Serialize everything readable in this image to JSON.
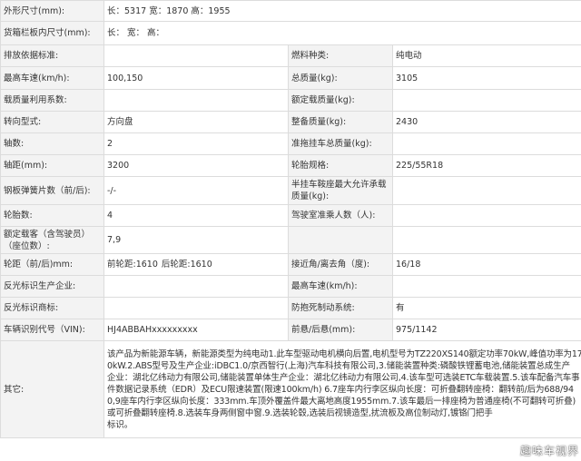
{
  "rows": [
    {
      "l1": "外形尺寸(mm):",
      "v1a": "长：5317 宽：1870 高：1955"
    },
    {
      "l1": "货箱栏板内尺寸(mm):",
      "v1a": "长：  宽：  高："
    },
    {
      "l1": "排放依据标准:",
      "v1": "",
      "l2": "燃料种类:",
      "v2": "纯电动"
    },
    {
      "l1": "最高车速(km/h):",
      "v1": "100,150",
      "l2": "总质量(kg):",
      "v2": "3105"
    },
    {
      "l1": "载质量利用系数:",
      "v1": "",
      "l2": "额定载质量(kg):",
      "v2": ""
    },
    {
      "l1": "转向型式:",
      "v1": "方向盘",
      "l2": "整备质量(kg):",
      "v2": "2430"
    },
    {
      "l1": "轴数:",
      "v1": "2",
      "l2": "准拖挂车总质量(kg):",
      "v2": ""
    },
    {
      "l1": "轴距(mm):",
      "v1": "3200",
      "l2": "轮胎规格:",
      "v2": "225/55R18"
    },
    {
      "l1": "钢板弹簧片数（前/后):",
      "v1": "-/-",
      "l2": "半挂车鞍座最大允许承载质量(kg):",
      "v2": ""
    },
    {
      "l1": "轮胎数:",
      "v1": "4",
      "l2": "驾驶室准乘人数（人):",
      "v2": ""
    },
    {
      "l1": "额定载客（含驾驶员）（座位数）:",
      "v1": "7,9",
      "l2": "",
      "v2": ""
    },
    {
      "l1": "轮距（前/后)mm:",
      "v1a": "前轮距:1610",
      "v1b": "后轮距:1610",
      "l2": "接近角/离去角（度):",
      "v2": "16/18"
    },
    {
      "l1": "反光标识生产企业:",
      "v1": "",
      "l2": "最高车速(km/h):",
      "v2": ""
    },
    {
      "l1": "反光标识商标:",
      "v1": "",
      "l2": "防抱死制动系统:",
      "v2": "有"
    },
    {
      "l1": "车辆识别代号（VIN):",
      "v1": "HJ4ABBAHxxxxxxxxx",
      "l2": "前悬/后悬(mm):",
      "v2": "975/1142"
    }
  ],
  "other": {
    "label": "其它:",
    "lines": [
      "该产品为新能源车辆，新能源类型为纯电动1.此车型驱动电机横向后置,电机型号为TZ220XS140额定功率70kW,峰值功率为17",
      "0kW.2.ABS型号及生产企业:iDBC1.0/京西智行(上海)汽车科技有限公司,3.储能装置种类:磷酸铁锂蓄电池,储能装置总成生产",
      "企业：湖北亿纬动力有限公司,储能装置单体生产企业：湖北亿纬动力有限公司,4.该车型可选装ETC车载装置.5.该车配备汽车事",
      "件数据记录系统（EDR）及ECU限速装置(限速100km/h) 6.7座车内行李区纵向长度：可折叠翻转座椅：翻转前/后为688/94",
      "0,9座车内行李区纵向长度：333mm.车顶外覆盖件最大离地高度1955mm.7.该车最后一排座椅为普通座椅(不可翻转可折叠)",
      "或可折叠翻转座椅.8.选装车身两侧窗中窗.9.选装轮毂,选装后视镜造型,扰流板及高位制动灯,镀铬门把手",
      "标识。"
    ]
  },
  "watermark": "趣味车视界"
}
